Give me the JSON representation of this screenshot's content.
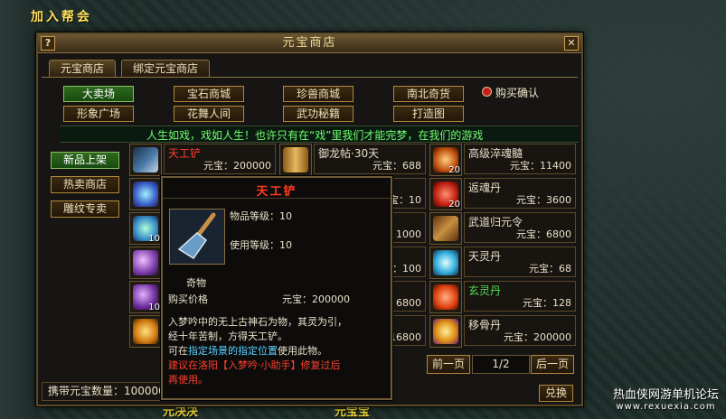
{
  "background": {
    "top_title": "加入帮会",
    "bottom_left": "元决决",
    "bottom_mid": "元宝宝",
    "watermark_line1": "热血侠网游单机论坛",
    "watermark_line2": "www.rexuexia.com"
  },
  "window": {
    "title": "元宝商店",
    "help_icon": "question-icon",
    "close_icon": "close-icon",
    "help_label": "?",
    "close_label": "✕"
  },
  "tabs": [
    {
      "label": "元宝商店",
      "active": true
    },
    {
      "label": "绑定元宝商店",
      "active": false
    }
  ],
  "categories": [
    {
      "label": "大卖场",
      "active": true
    },
    {
      "label": "宝石商城",
      "active": false
    },
    {
      "label": "珍兽商城",
      "active": false
    },
    {
      "label": "南北奇货",
      "active": false
    },
    {
      "label": "形象广场",
      "active": false
    },
    {
      "label": "花舞人间",
      "active": false
    },
    {
      "label": "武功秘籍",
      "active": false
    },
    {
      "label": "打造图",
      "active": false
    }
  ],
  "confirm_purchase": {
    "label": "购买确认",
    "checked": true
  },
  "marquee": "人生如戏，戏如人生！也许只有在“戏”里我们才能完梦，在我们的游戏",
  "side_buttons": [
    {
      "label": "新品上架",
      "active": true
    },
    {
      "label": "热卖商店",
      "active": false
    },
    {
      "label": "雕纹专卖",
      "active": false
    }
  ],
  "items_left": [
    {
      "name": "天工铲",
      "price": "元宝：200000",
      "qty": "",
      "icon": "shovel-icon",
      "name_color": "red"
    },
    {
      "name": "",
      "price": "",
      "qty": "",
      "icon": "gem-icon",
      "name_color": "normal"
    },
    {
      "name": "",
      "price": "",
      "qty": "10",
      "icon": "gem-icon",
      "name_color": "normal"
    },
    {
      "name": "",
      "price": "",
      "qty": "",
      "icon": "potion-icon",
      "name_color": "normal"
    },
    {
      "name": "",
      "price": "",
      "qty": "10",
      "icon": "potion-icon",
      "name_color": "normal"
    },
    {
      "name": "",
      "price": "",
      "qty": "",
      "icon": "dragon-icon",
      "name_color": "normal"
    }
  ],
  "items_mid": [
    {
      "name": "御龙帖·30天",
      "price": "元宝：688",
      "qty": "",
      "icon": "scroll-icon"
    },
    {
      "name": "",
      "price": "元宝：10",
      "qty": "",
      "icon": ""
    },
    {
      "name": "",
      "price": "元宝：1000",
      "qty": "",
      "icon": ""
    },
    {
      "name": "",
      "price": "元宝：100",
      "qty": "",
      "icon": ""
    },
    {
      "name": "",
      "price": "元宝：6800",
      "qty": "",
      "icon": ""
    },
    {
      "name": "",
      "price": "元宝：16800",
      "qty": "",
      "icon": ""
    }
  ],
  "items_right": [
    {
      "name": "高级淬魂髓",
      "price": "元宝：11400",
      "qty": "20",
      "icon": "orb-icon",
      "name_color": "normal"
    },
    {
      "name": "返魂丹",
      "price": "元宝：3600",
      "qty": "20",
      "icon": "pill-icon",
      "name_color": "normal"
    },
    {
      "name": "武道归元令",
      "price": "元宝：6800",
      "qty": "",
      "icon": "token-icon",
      "name_color": "normal"
    },
    {
      "name": "天灵丹",
      "price": "元宝：68",
      "qty": "",
      "icon": "swirl-icon",
      "name_color": "normal"
    },
    {
      "name": "玄灵丹",
      "price": "元宝：128",
      "qty": "",
      "icon": "pill-icon",
      "name_color": "green"
    },
    {
      "name": "移骨丹",
      "price": "元宝：200000",
      "qty": "",
      "icon": "sun-icon",
      "name_color": "normal"
    }
  ],
  "pager": {
    "prev": "前一页",
    "page": "1/2",
    "next": "后一页"
  },
  "balance": "携带元宝数量：100000",
  "exchange": "兑换",
  "tooltip": {
    "title": "天工铲",
    "icon": "shovel-icon",
    "item_level": "物品等级：10",
    "use_level": "使用等级：10",
    "type": "奇物",
    "price_label": "购买价格",
    "price": "元宝：200000",
    "desc1": "入梦吟中的无上古神石为物，其灵为引，",
    "desc2": "经十年苦制，方得天工铲。",
    "desc3_a": "可在",
    "desc3_link": "指定场景的指定位置",
    "desc3_b": "使用此物。",
    "desc4": "建议在洛阳【入梦吟·小助手】修复过后",
    "desc5": "再使用。"
  }
}
